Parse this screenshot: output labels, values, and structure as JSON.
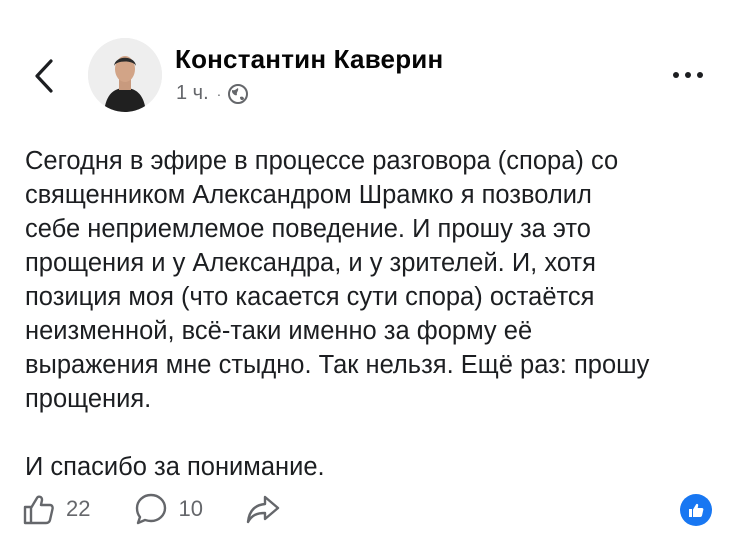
{
  "header": {
    "back_icon": "chevron-left-icon",
    "author_name": "Константин Каверин",
    "time_ago": "1 ч.",
    "separator": "·",
    "audience_icon": "globe-icon",
    "more_icon": "ellipsis-icon"
  },
  "post": {
    "paragraphs": [
      "Сегодня в эфире в процессе разговора (спора) со\nсвященником Александром Шрамко я позволил\nсебе неприемлемое поведение. И прошу за это\nпрощения и у Александра, и у зрителей. И, хотя\nпозиция моя (что касается сути спора) остаётся\nнеизменной, всё-таки именно за форму её\nвыражения мне стыдно. Так нельзя. Ещё раз: прошу\nпрощения.",
      "И спасибо за понимание."
    ]
  },
  "actions": {
    "like_icon": "thumbs-up-icon",
    "like_count": "22",
    "comment_icon": "comment-bubble-icon",
    "comment_count": "10",
    "share_icon": "share-arrow-icon",
    "reaction_icon": "like-reaction-badge-icon"
  },
  "colors": {
    "accent": "#1877f2",
    "secondary_text": "#65676b",
    "primary_text": "#1c1e21"
  }
}
